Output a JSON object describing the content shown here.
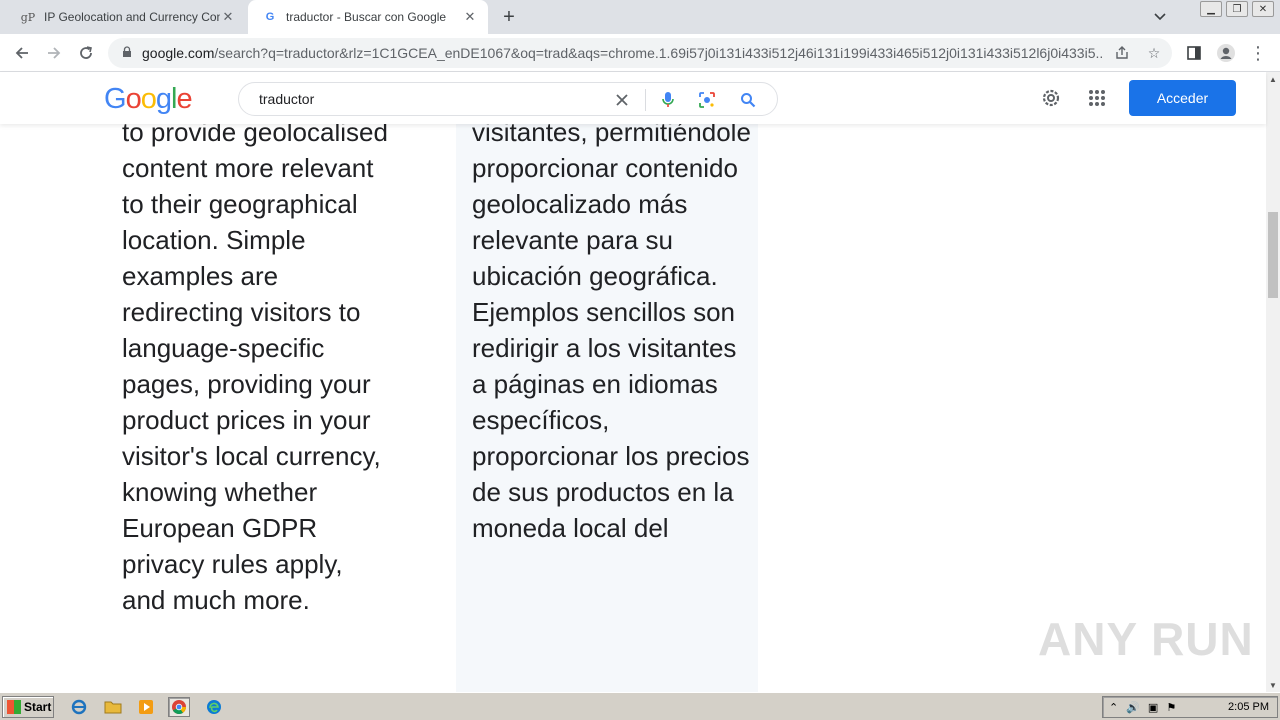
{
  "browser": {
    "tabs": [
      {
        "title": "IP Geolocation and Currency Conver",
        "favicon": "gP"
      },
      {
        "title": "traductor - Buscar con Google",
        "favicon": "G"
      }
    ],
    "address": {
      "host": "google.com",
      "path": "/search?q=traductor&rlz=1C1GCEA_enDE1067&oq=trad&aqs=chrome.1.69i57j0i131i433i512j46i131i199i433i465i512j0i131i433i512l6j0i433i5..."
    }
  },
  "google": {
    "logo": [
      "G",
      "o",
      "o",
      "g",
      "l",
      "e"
    ],
    "logo_colors": [
      "#4285f4",
      "#ea4335",
      "#fbbc05",
      "#4285f4",
      "#34a853",
      "#ea4335"
    ],
    "search_query": "traductor",
    "signin_label": "Acceder",
    "accent": "#1a73e8"
  },
  "content": {
    "left_text": "to provide geolocalised content more relevant to their geographical location. Simple examples are redirecting visitors to language-specific pages, providing your product prices in your visitor's local currency, knowing whether European GDPR privacy rules apply, and much more.",
    "right_text": "visitantes, permitiéndole proporcionar contenido geolocalizado más relevante para su ubicación geográfica. Ejemplos sencillos son redirigir a los visitantes a páginas en idiomas específicos, proporcionar los precios de sus productos en la moneda local del"
  },
  "watermark": "ANY RUN",
  "taskbar": {
    "start_label": "Start",
    "clock": "2:05 PM"
  }
}
